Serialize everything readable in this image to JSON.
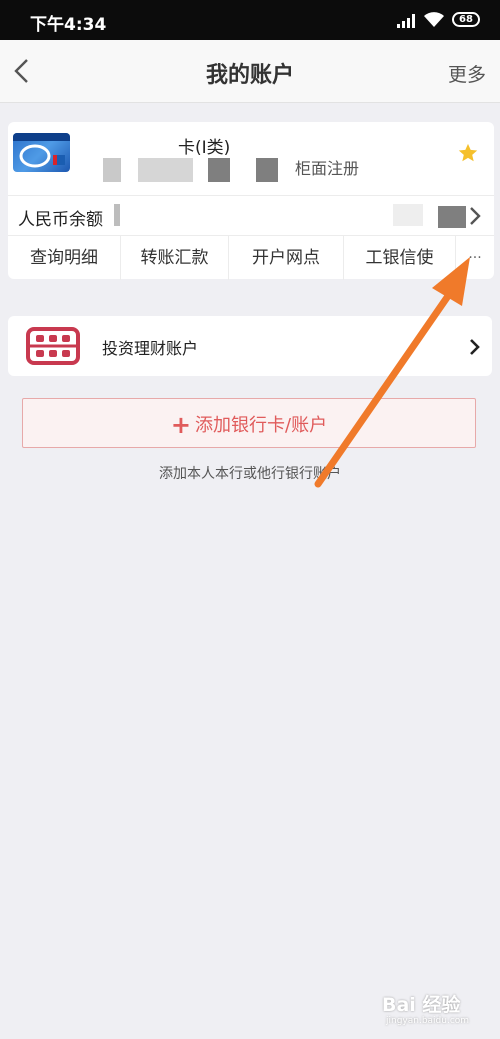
{
  "status_bar": {
    "time": "下午4:34",
    "battery": "68"
  },
  "nav": {
    "title": "我的账户",
    "more": "更多"
  },
  "account_card": {
    "card_name_partial": "卡(I类)",
    "registration": "柜面注册",
    "balance_label": "人民币余额",
    "actions": [
      "查询明细",
      "转账汇款",
      "开户网点",
      "工银信使",
      "···"
    ]
  },
  "invest": {
    "label": "投资理财账户"
  },
  "add_card": {
    "label": "添加银行卡/账户",
    "hint": "添加本人本行或他行银行账户"
  },
  "watermark": {
    "text": "Bai 经验",
    "sub": "jingyan.baidu.com"
  },
  "colors": {
    "accent": "#e05b5b",
    "star": "#f5c02c",
    "arrow": "#f07a2a",
    "abacus": "#c8394f"
  }
}
